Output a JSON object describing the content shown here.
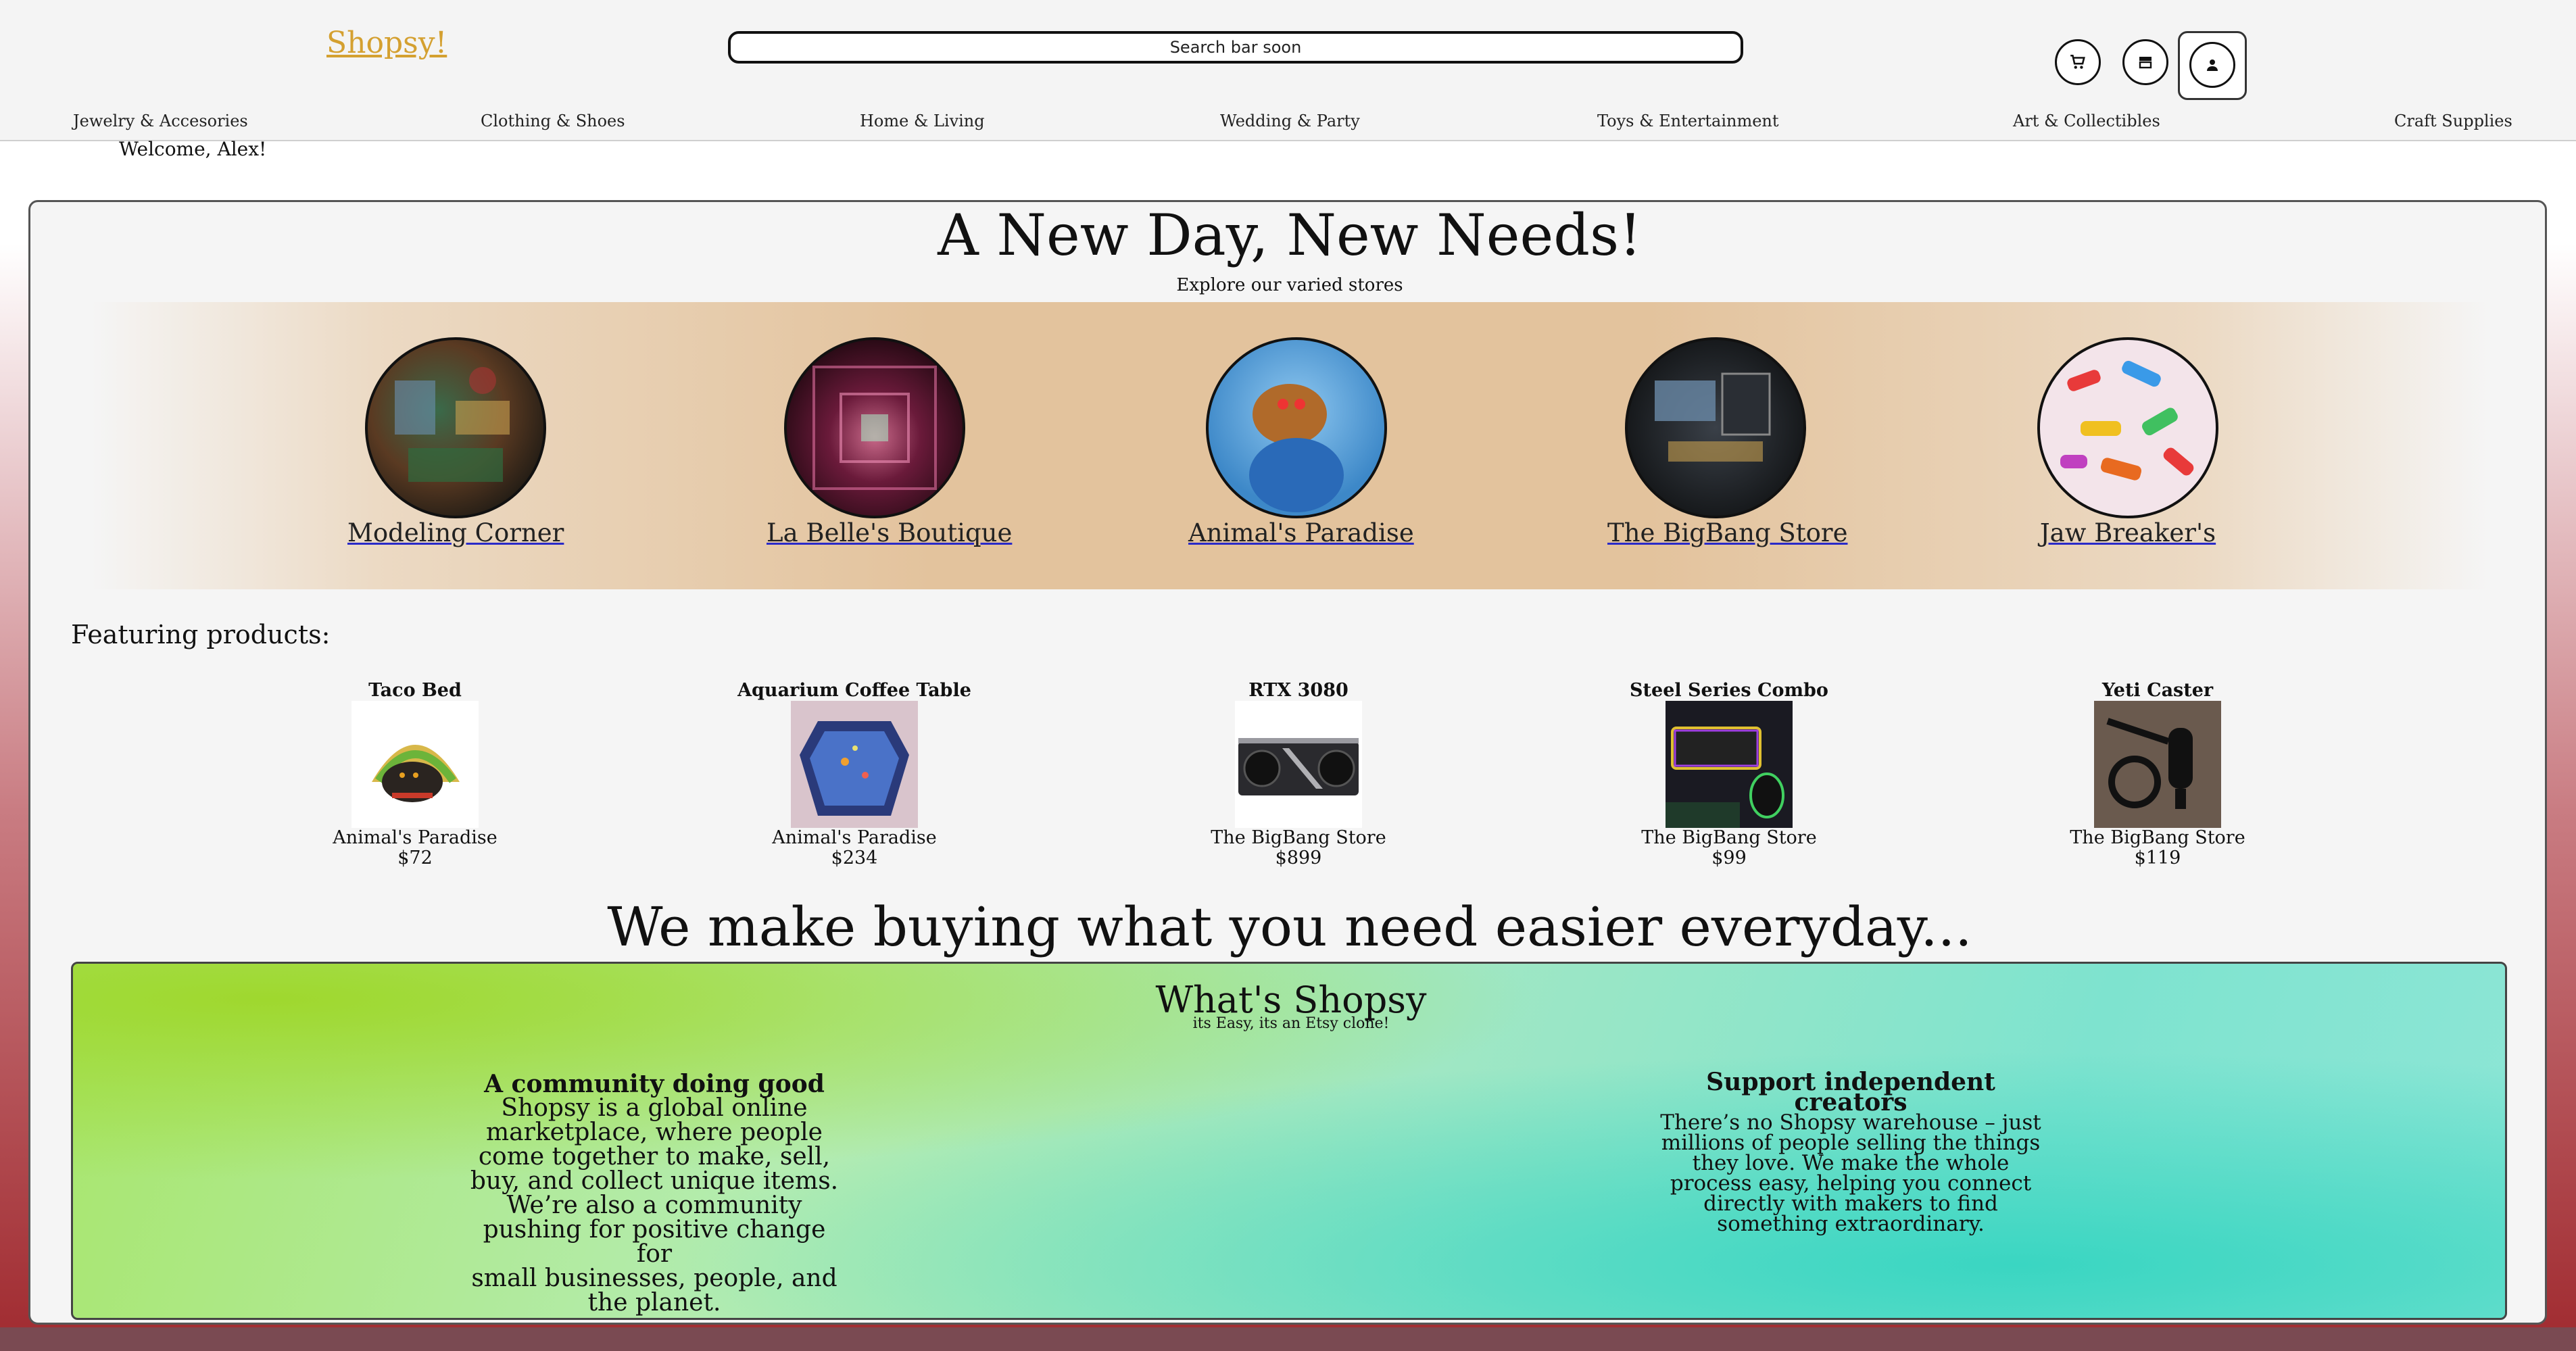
{
  "header": {
    "logo": "Shopsy!",
    "search_placeholder": "Search bar soon",
    "icons": [
      "cart-icon",
      "store-icon",
      "user-icon"
    ]
  },
  "nav": [
    "Jewelry & Accesories",
    "Clothing & Shoes",
    "Home & Living",
    "Wedding & Party",
    "Toys & Entertainment",
    "Art & Collectibles",
    "Craft Supplies"
  ],
  "welcome": "Welcome, Alex!",
  "hero": {
    "title": "A New Day, New Needs!",
    "subtitle": "Explore our varied stores"
  },
  "stores": [
    {
      "name": "Modeling Corner"
    },
    {
      "name": "La Belle's Boutique"
    },
    {
      "name": "Animal's Paradise"
    },
    {
      "name": "The BigBang Store"
    },
    {
      "name": "Jaw Breaker's"
    }
  ],
  "featuring": {
    "label": "Featuring products:",
    "products": [
      {
        "name": "Taco Bed",
        "store": "Animal's Paradise",
        "price": "$72"
      },
      {
        "name": "Aquarium Coffee Table",
        "store": "Animal's Paradise",
        "price": "$234"
      },
      {
        "name": "RTX 3080",
        "store": "The BigBang Store",
        "price": "$899"
      },
      {
        "name": "Steel Series Combo",
        "store": "The BigBang Store",
        "price": "$99"
      },
      {
        "name": "Yeti Caster",
        "store": "The BigBang Store",
        "price": "$119"
      }
    ]
  },
  "tagline": "We make buying what you need easier everyday...",
  "about": {
    "title": "What's Shopsy",
    "subtitle": "its Easy, its an Etsy clone!",
    "left": {
      "heading": "A community doing good",
      "lines": [
        "Shopsy is a global online",
        "marketplace, where people",
        "come together to make, sell,",
        "buy, and collect unique items.",
        "We’re also a community",
        "pushing for positive change for",
        "small businesses, people, and",
        "the planet."
      ]
    },
    "right": {
      "heading": "Support independent creators",
      "lines": [
        "There’s no Shopsy warehouse – just",
        "millions of people selling the things",
        "they love. We make the whole",
        "process easy, helping you connect",
        "directly with makers to find",
        "something extraordinary."
      ]
    }
  },
  "colors": {
    "logo": "#d4a030",
    "band": "#e3c39d",
    "link_underline": "#2a2ac8"
  }
}
